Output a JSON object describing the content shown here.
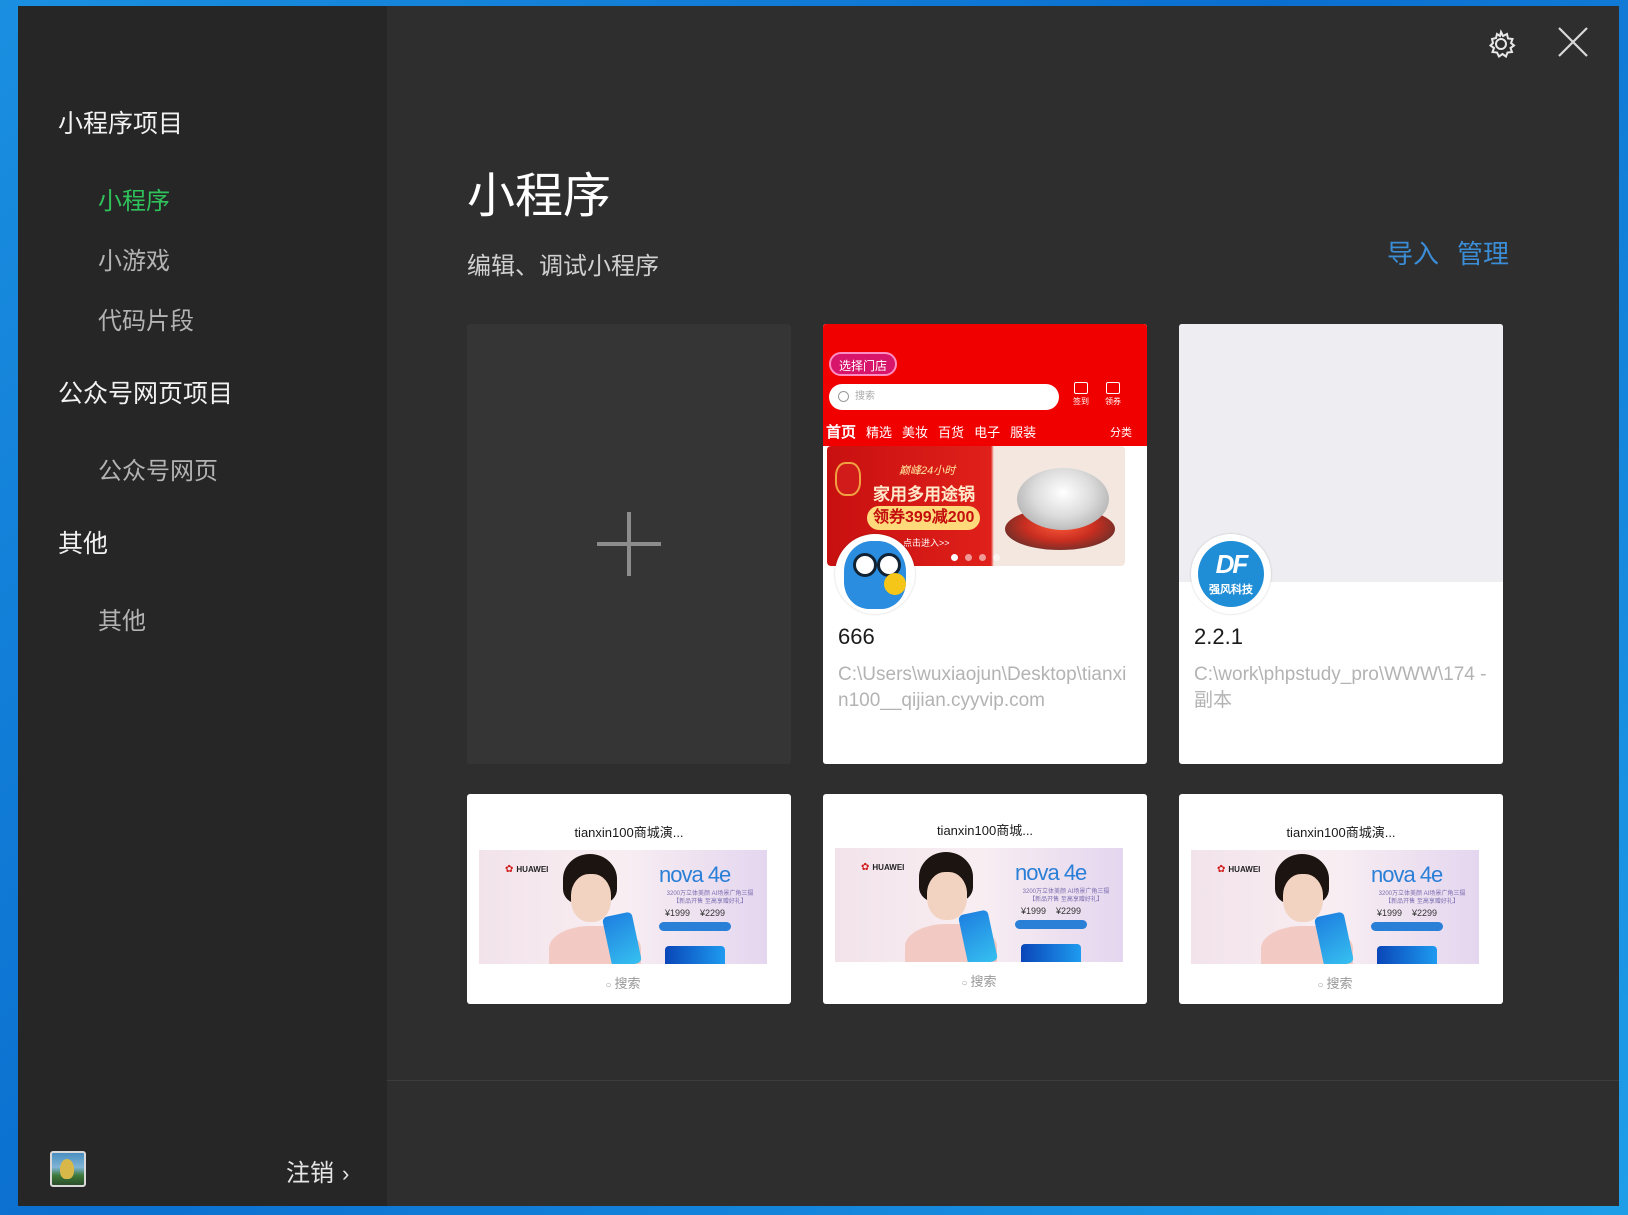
{
  "sidebar": {
    "groups": [
      {
        "label": "小程序项目",
        "items": [
          {
            "label": "小程序"
          },
          {
            "label": "小游戏"
          },
          {
            "label": "代码片段"
          }
        ]
      },
      {
        "label": "公众号网页项目",
        "items": [
          {
            "label": "公众号网页"
          }
        ]
      },
      {
        "label": "其他",
        "items": [
          {
            "label": "其他"
          }
        ]
      }
    ],
    "active_item": "小程序",
    "footer": {
      "logout_label": "注销",
      "chevron": "›"
    }
  },
  "header": {
    "icons": [
      "gear-icon",
      "close-icon"
    ],
    "title": "小程序",
    "subtitle": "编辑、调试小程序",
    "actions": {
      "import_label": "导入",
      "manage_label": "管理"
    }
  },
  "projects": [
    {
      "name": "666",
      "path": "C:\\Users\\wuxiaojun\\Desktop\\tianxin100__qijian.cyyvip.com",
      "thumbnail": {
        "store_pill": "选择门店",
        "search_placeholder": "搜索",
        "icon_labels": [
          "签到",
          "领券"
        ],
        "tabs": [
          "首页",
          "精选",
          "美妆",
          "百货",
          "电子",
          "服装"
        ],
        "category_label": "分类",
        "banner": {
          "line1": "巅峰24小时",
          "line2": "家用多用途锅",
          "line3": "领券399减200",
          "line4": "点击进入>>"
        }
      }
    },
    {
      "name": "2.2.1",
      "path": "C:\\work\\phpstudy_pro\\WWW\\174 - 副本",
      "logo": {
        "big": "DF",
        "small": "强风科技"
      }
    }
  ],
  "demo_projects": [
    {
      "title": "tianxin100商城演...",
      "search": "搜索"
    },
    {
      "title": "tianxin100商城...",
      "search": "搜索"
    },
    {
      "title": "tianxin100商城演...",
      "search": "搜索"
    }
  ],
  "demo_banner": {
    "brand": "HUAWEI",
    "product": "nova 4e",
    "tagline": "3200万立体美颜  AI场景广角三摄",
    "tagline2": "【新品开售 至高享赠好礼】",
    "prices": [
      "¥1999",
      "¥2299"
    ]
  },
  "colors": {
    "accent_green": "#2fc25b",
    "link_blue": "#3a8dd6",
    "sidebar_bg": "#262626",
    "main_bg": "#2e2e2e"
  }
}
